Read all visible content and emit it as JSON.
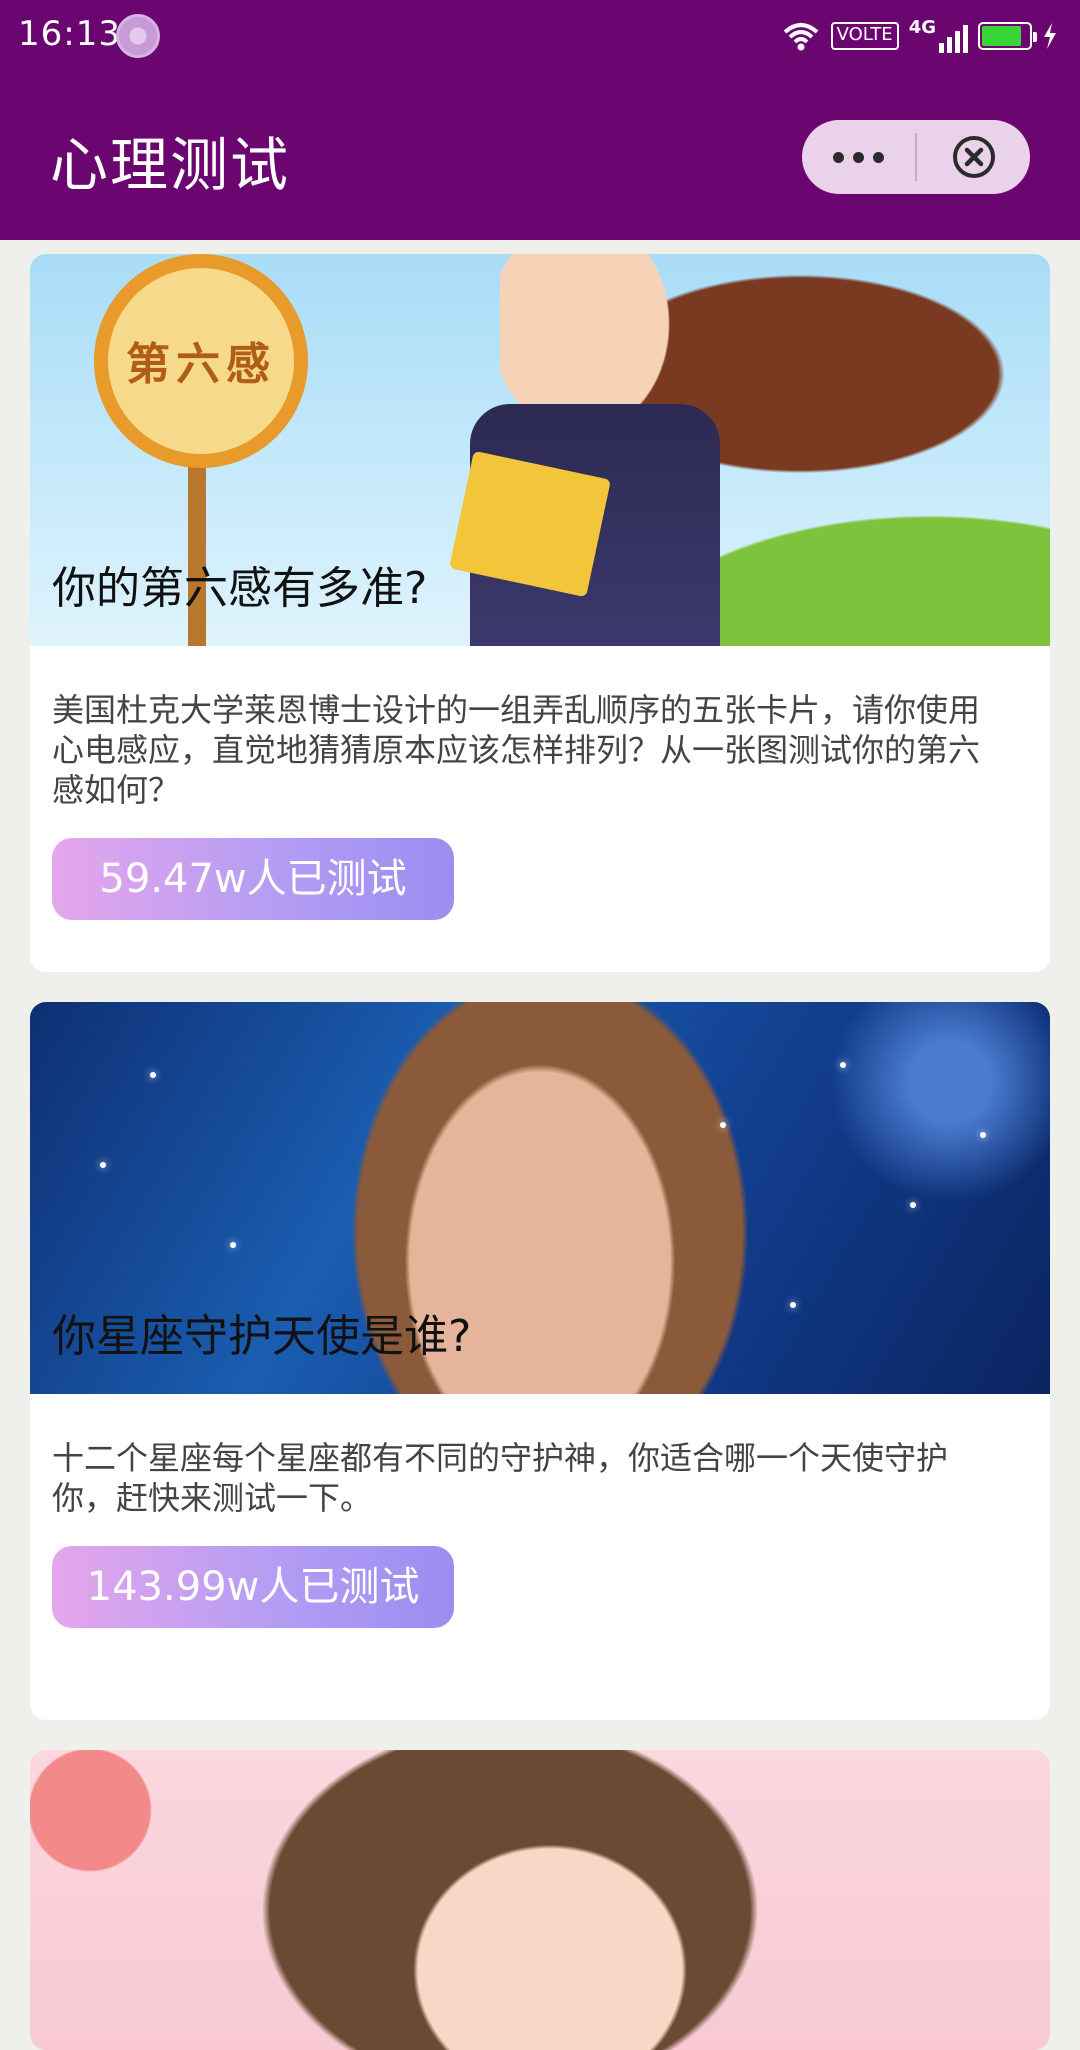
{
  "status_bar": {
    "time": "16:13",
    "volte": "VOLTE",
    "network": "4G",
    "battery_level": 0.85,
    "icons": [
      "loading-spinner-icon",
      "wifi-icon",
      "volte-icon",
      "signal-icon",
      "battery-icon",
      "charging-icon"
    ]
  },
  "header": {
    "title": "心理测试",
    "background_color": "#6b0670",
    "menu_icon": "more-dots-icon",
    "close_icon": "close-circle-icon"
  },
  "cards": [
    {
      "title": "你的第六感有多准?",
      "sign_text": "第六感",
      "description": "美国杜克大学莱恩博士设计的一组弄乱顺序的五张卡片，请你使用心电感应，直觉地猜猜原本应该怎样排列？从一张图测试你的第六感如何？",
      "tested_count": "59.47w人已测试"
    },
    {
      "title": "你星座守护天使是谁?",
      "description": "十二个星座每个星座都有不同的守护神，你适合哪一个天使守护你，赶快来测试一下。",
      "tested_count": "143.99w人已测试"
    },
    {
      "title": "",
      "description": "",
      "tested_count": ""
    }
  ],
  "accent_colors": {
    "badge_gradient_start": "#e5a6ec",
    "badge_gradient_end": "#9a8ef1",
    "page_background": "#efefec"
  }
}
